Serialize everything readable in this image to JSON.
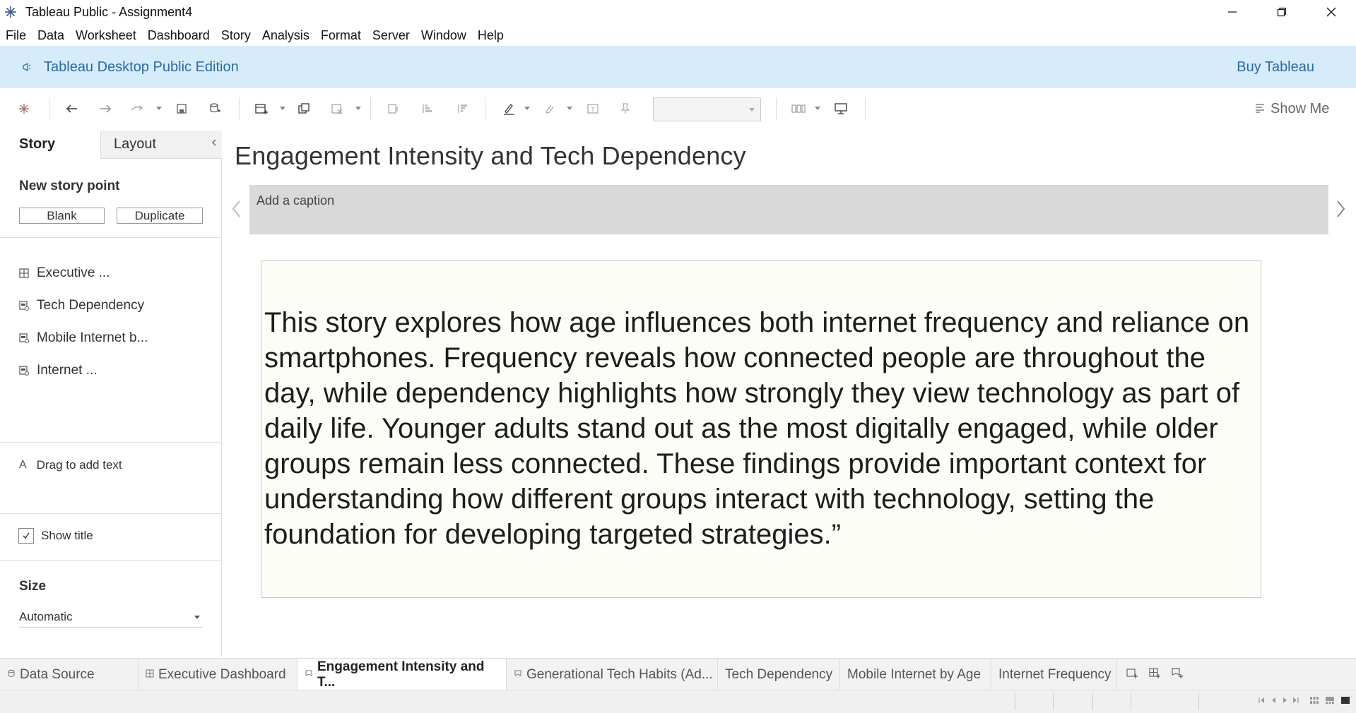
{
  "window": {
    "title": "Tableau Public - Assignment4"
  },
  "menu": [
    "File",
    "Data",
    "Worksheet",
    "Dashboard",
    "Story",
    "Analysis",
    "Format",
    "Server",
    "Window",
    "Help"
  ],
  "banner": {
    "edition": "Tableau Desktop Public Edition",
    "buy": "Buy Tableau"
  },
  "toolbar": {
    "show_me": "Show Me",
    "fit_value": ""
  },
  "left_panel": {
    "tab_story": "Story",
    "tab_layout": "Layout",
    "new_story_point": "New story point",
    "blank_button": "Blank",
    "duplicate_button": "Duplicate",
    "sheets": [
      {
        "label": "Executive ...",
        "icon": "dashboard-icon"
      },
      {
        "label": "Tech Dependency",
        "icon": "worksheet-icon"
      },
      {
        "label": "Mobile Internet b...",
        "icon": "worksheet-icon"
      },
      {
        "label": "Internet ...",
        "icon": "worksheet-icon"
      }
    ],
    "drag_to_add_text": "Drag to add text",
    "show_title": "Show title",
    "show_title_checked": true,
    "size_heading": "Size",
    "size_value": "Automatic"
  },
  "story": {
    "title": "Engagement Intensity and Tech Dependency",
    "caption_placeholder": "Add a caption",
    "body_text": "This story explores how age influences both internet frequency and reliance on smartphones. Frequency reveals how connected people are throughout the day, while dependency highlights how strongly they view technology as part of daily life. Younger adults stand out as the most digitally engaged, while older groups remain less connected. These findings provide important context for understanding how different groups interact with technology, setting the foundation for developing targeted strategies.”"
  },
  "sheet_tabs": [
    {
      "label": "Data Source",
      "icon": "data-source-icon",
      "active": false
    },
    {
      "label": "Executive Dashboard",
      "icon": "dashboard-icon",
      "active": false
    },
    {
      "label": "Engagement Intensity and T...",
      "icon": "story-icon",
      "active": true
    },
    {
      "label": "Generational Tech Habits (Ad...",
      "icon": "story-icon",
      "active": false
    },
    {
      "label": "Tech Dependency",
      "icon": "",
      "active": false
    },
    {
      "label": "Mobile Internet by Age",
      "icon": "",
      "active": false
    },
    {
      "label": "Internet Frequency",
      "icon": "",
      "active": false
    }
  ],
  "colors": {
    "banner_bg": "#d6ecfb",
    "banner_text": "#2a6aa8",
    "caption_bg": "#d9d9d9",
    "text_box_bg": "#fdfdf8"
  }
}
